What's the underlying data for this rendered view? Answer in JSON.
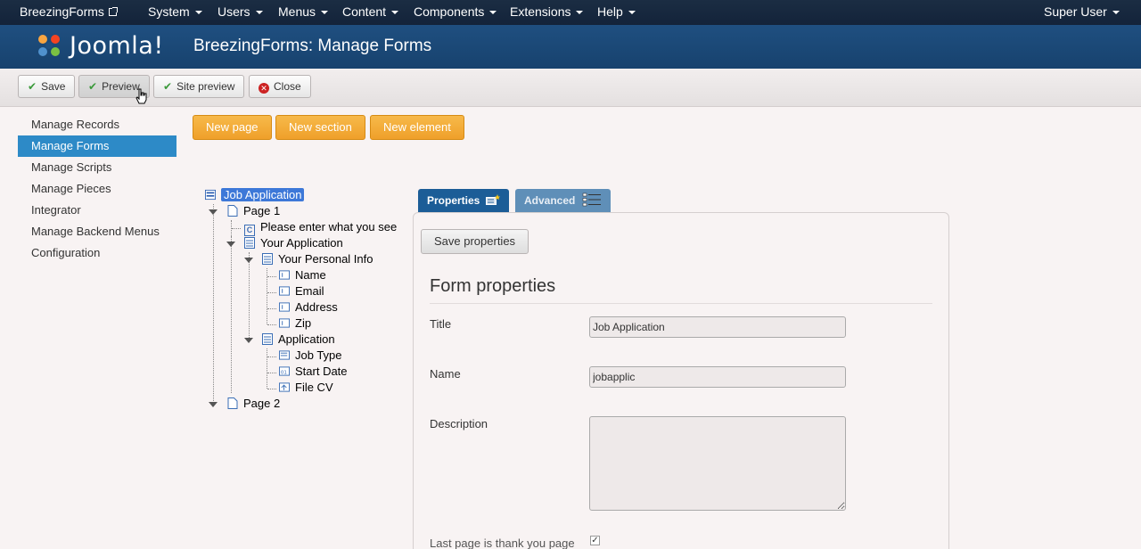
{
  "topnav": {
    "brand": "BreezingForms",
    "menus": [
      "System",
      "Users",
      "Menus",
      "Content",
      "Components",
      "Extensions",
      "Help"
    ],
    "user": "Super User"
  },
  "header": {
    "logo_text": "Joomla!",
    "title": "BreezingForms: Manage Forms"
  },
  "toolbar": {
    "save": "Save",
    "preview": "Preview",
    "site_preview": "Site preview",
    "close": "Close"
  },
  "sidebar": {
    "items": [
      "Manage Records",
      "Manage Forms",
      "Manage Scripts",
      "Manage Pieces",
      "Integrator",
      "Manage Backend Menus",
      "Configuration"
    ],
    "active": "Manage Forms"
  },
  "actions": {
    "new_page": "New page",
    "new_section": "New section",
    "new_element": "New element"
  },
  "tree": {
    "root": "Job Application",
    "page1": "Page 1",
    "captcha": "Please enter what you see",
    "your_application": "Your Application",
    "personal_info": "Your Personal Info",
    "name": "Name",
    "email": "Email",
    "address": "Address",
    "zip": "Zip",
    "application": "Application",
    "job_type": "Job Type",
    "start_date": "Start Date",
    "file_cv": "File CV",
    "page2": "Page 2"
  },
  "tabs": {
    "properties": "Properties",
    "advanced": "Advanced"
  },
  "properties": {
    "save_button": "Save properties",
    "heading": "Form properties",
    "title_label": "Title",
    "title_value": "Job Application",
    "name_label": "Name",
    "name_value": "jobapplic",
    "description_label": "Description",
    "description_value": "",
    "last_page_label": "Last page is thank you page",
    "last_page_checked": true
  },
  "colors": {
    "topbar": "#1b2d43",
    "header": "#1f4f80",
    "sidebar_active": "#2d8ac7",
    "orange_button": "#f0a22e",
    "tab_active": "#1c5d97"
  }
}
